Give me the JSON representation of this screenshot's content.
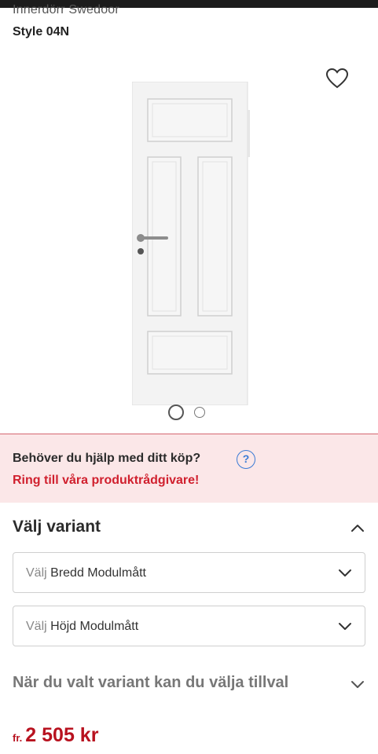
{
  "product": {
    "brand": "Innerdörr Swedoor",
    "title": "Style 04N"
  },
  "gallery": {
    "image_alt": "Vit innerdörr med fem fyllningar",
    "slide_count": 2,
    "active_slide": 1
  },
  "help_banner": {
    "question": "Behöver du hjälp med ditt köp?",
    "help_icon": "?",
    "cta": "Ring till våra produktrådgivare!"
  },
  "variant": {
    "title": "Välj variant",
    "selects": [
      {
        "prefix": "Välj",
        "label": "Bredd Modulmått"
      },
      {
        "prefix": "Välj",
        "label": "Höjd Modulmått"
      }
    ]
  },
  "tillval": {
    "label": "När du valt variant kan du välja tillval"
  },
  "price": {
    "prefix": "fr.",
    "amount": "2 505 kr"
  },
  "colors": {
    "accent_red": "#d0202e",
    "price_red": "#b8121f",
    "banner_bg": "#fbe7e8",
    "help_blue": "#3a7bd5"
  },
  "icons": {
    "favorite": "heart-icon",
    "help": "question-circle-icon",
    "expand": "chevron-up-icon",
    "select": "chevron-down-icon"
  }
}
